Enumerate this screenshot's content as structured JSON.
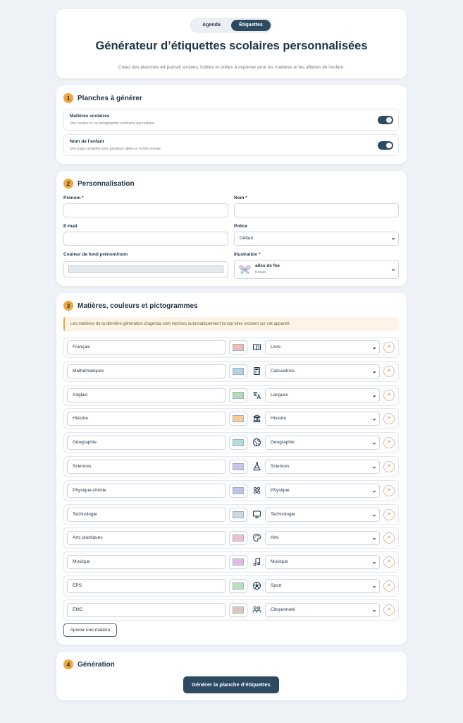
{
  "header": {
    "tabs": [
      {
        "label": "Agenda",
        "active": false
      },
      {
        "label": "Étiquettes",
        "active": true
      }
    ],
    "title": "Générateur d’étiquettes scolaires personnalisées",
    "subtitle": "Créez des planches A4 portrait simples, lisibles et prêtes à imprimer pour les matières et les affaires de l’enfant."
  },
  "section1": {
    "number": "1",
    "title": "Planches à générer",
    "options": [
      {
        "label": "Matières scolaires",
        "description": "Une couleur et un pictogramme cohérents par matière.",
        "enabled": true
      },
      {
        "label": "Nom de l’enfant",
        "description": "Une page complète avec plusieurs tailles et l’icône choisie.",
        "enabled": true
      }
    ]
  },
  "section2": {
    "number": "2",
    "title": "Personnalisation",
    "prenom_label": "Prénom *",
    "prenom_value": "",
    "nom_label": "Nom *",
    "nom_value": "",
    "email_label": "E-mail",
    "email_value": "",
    "police_label": "Police",
    "police_value": "Défaut",
    "couleur_label": "Couleur de fond prénom/nom",
    "illustration_label": "Illustration *",
    "illustration_name": "ailes de fee",
    "illustration_style": "Kawaii"
  },
  "section3": {
    "number": "3",
    "title": "Matières, couleurs et pictogrammes",
    "notice": "Les matières de la dernière génération d’agenda sont reprises automatiquement lorsqu’elles existent sur cet appareil.",
    "remove_symbol": "×",
    "subjects": [
      {
        "name": "Français",
        "color": "#efb3a9",
        "icon": "book-icon",
        "picto": "Livre"
      },
      {
        "name": "Mathématiques",
        "color": "#a9cde3",
        "icon": "calculator-icon",
        "picto": "Calculatrice"
      },
      {
        "name": "Anglais",
        "color": "#a8d8aa",
        "icon": "translate-icon",
        "picto": "Langues"
      },
      {
        "name": "Histoire",
        "color": "#f6c489",
        "icon": "museum-icon",
        "picto": "Histoire"
      },
      {
        "name": "Géographie",
        "color": "#a8d8d4",
        "icon": "globe-icon",
        "picto": "Géographie"
      },
      {
        "name": "Sciences",
        "color": "#c4bce6",
        "icon": "flask-icon",
        "picto": "Sciences"
      },
      {
        "name": "Physique-chimie",
        "color": "#b6bce6",
        "icon": "atom-icon",
        "picto": "Physique"
      },
      {
        "name": "Technologie",
        "color": "#c7d3dc",
        "icon": "monitor-icon",
        "picto": "Technologie"
      },
      {
        "name": "Arts plastiques",
        "color": "#eeb3c8",
        "icon": "palette-icon",
        "picto": "Arts"
      },
      {
        "name": "Musique",
        "color": "#dcb2de",
        "icon": "music-note-icon",
        "picto": "Musique"
      },
      {
        "name": "EPS",
        "color": "#b2dcb0",
        "icon": "soccer-ball-icon",
        "picto": "Sport"
      },
      {
        "name": "EMC",
        "color": "#d4c1b0",
        "icon": "people-icon",
        "picto": "Citoyenneté"
      }
    ],
    "add_label": "Ajouter une matière"
  },
  "section4": {
    "number": "4",
    "title": "Génération",
    "button_label": "Générer la planche d’étiquettes"
  },
  "colors": {
    "accent": "#f0a63a",
    "primary": "#2d4a63",
    "background": "#eef2f6"
  }
}
